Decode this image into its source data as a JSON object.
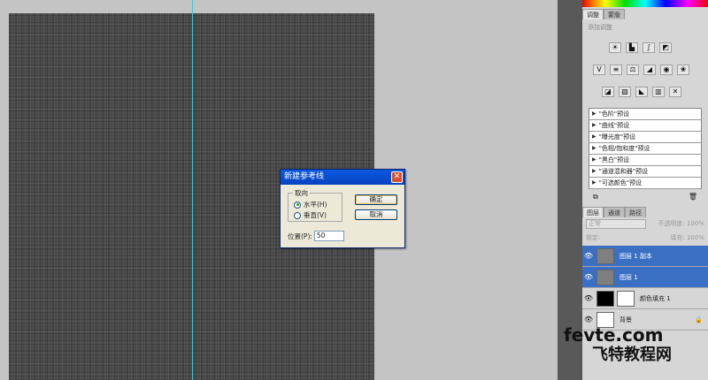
{
  "dialog": {
    "title": "新建参考线",
    "orientation_label": "取向",
    "horizontal_label": "水平(H)",
    "vertical_label": "垂直(V)",
    "position_label": "位置(P):",
    "position_value": "50",
    "ok_label": "确定",
    "cancel_label": "取消",
    "close_glyph": "✕"
  },
  "adjustments": {
    "tabs": [
      "调整",
      "蒙版"
    ],
    "subtitle": "添加调整",
    "presets": [
      "\"色阶\"预设",
      "\"曲线\"预设",
      "\"曝光度\"预设",
      "\"色相/饱和度\"预设",
      "\"黑白\"预设",
      "\"通道混和器\"预设",
      "\"可选颜色\"预设"
    ]
  },
  "layers_panel": {
    "tabs": [
      "图层",
      "通道",
      "路径"
    ],
    "blend_mode": "正常",
    "opacity_label": "不透明度: 100%",
    "lock_label": "锁定:",
    "fill_label": "填充: 100%",
    "layers": [
      {
        "name": "图层 1 副本",
        "selected": true
      },
      {
        "name": "图层 1",
        "selected": true
      },
      {
        "name": "颜色填充 1",
        "selected": false
      },
      {
        "name": "背景",
        "selected": false
      }
    ]
  },
  "watermark": {
    "line1": "fevte.com",
    "line2": "飞特教程网"
  },
  "colors": {
    "guide": "#3cc6d0",
    "selection": "#3a6fc4",
    "dialog_title": "#0a5ae0"
  }
}
